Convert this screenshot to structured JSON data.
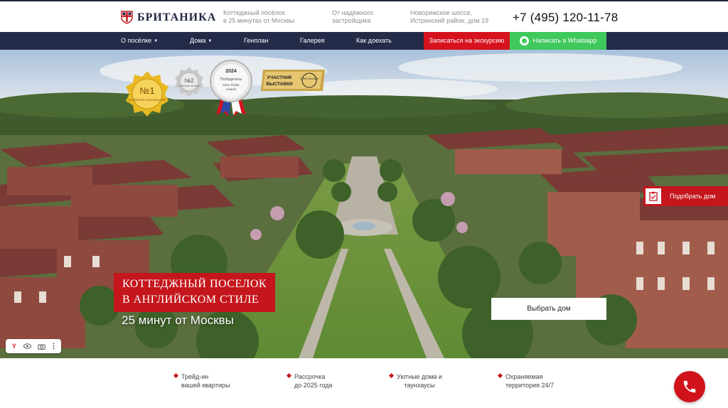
{
  "header": {
    "logo_text": "БРИТАНИКА",
    "info": [
      {
        "text": "Коттеджный посёлок\nв 25 минутах от Москвы"
      },
      {
        "text": "От надёжного\nзастройщика"
      },
      {
        "text": "Новорижское шоссе,\nИстринский район, дом 19"
      }
    ],
    "phone": "+7 (495) 120-11-78"
  },
  "nav": {
    "items": [
      {
        "label": "О посёлке",
        "has_caret": true
      },
      {
        "label": "Дома",
        "has_caret": true
      },
      {
        "label": "Генплан",
        "has_caret": false
      },
      {
        "label": "Галерея",
        "has_caret": false
      },
      {
        "label": "Как доехать",
        "has_caret": false
      }
    ],
    "tour_button": "Записаться на экскурсию",
    "whatsapp_button": "Написать в Whatsapp",
    "caret": "▼"
  },
  "badges": {
    "badge1_main": "№1",
    "badge1_sub": "В РЕЙТИНГЕ ПОСЕЛКОВ 2023",
    "badge2_main": "№2",
    "badge2_sub": "В РЕЙТИНГЕ ПОСЕЛКОВ",
    "award_year": "2024",
    "award_line1": "Победитель",
    "award_line2": "Move Realty",
    "award_line3": "Awards",
    "expo_line1": "УЧАСТНИК",
    "expo_line2": "ВЫСТАВКИ",
    "expo_tag": "OPEN VILLAGE"
  },
  "hero": {
    "title": "КОТТЕДЖНЫЙ ПОСЕЛОК\nВ АНГЛИЙСКОМ СТИЛЕ",
    "subtitle": "25 минут от Москвы",
    "choose_button": "Выбрать дом",
    "pick_button": "Подобрать дом"
  },
  "features": [
    {
      "line1": "Трейд-ин",
      "line2": "вашей квартиры"
    },
    {
      "line1": "Рассрочка",
      "line2": "до 2025 года"
    },
    {
      "line1": "Уютные дома и",
      "line2": "таунхаусы"
    },
    {
      "line1": "Охраняемая",
      "line2": "территория 24/7"
    }
  ],
  "colors": {
    "brand_navy": "#232b48",
    "accent_red": "#c4161c",
    "whatsapp_green": "#3fc85c"
  }
}
